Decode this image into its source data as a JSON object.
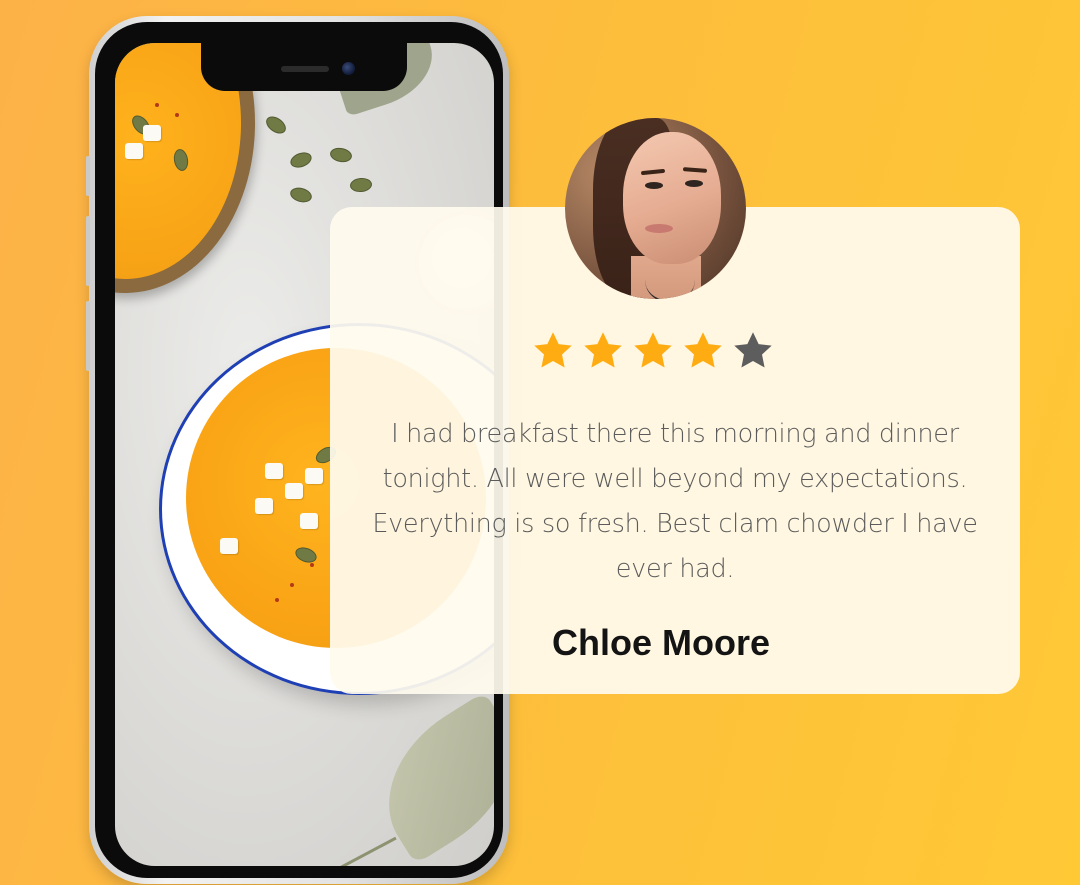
{
  "testimonial": {
    "rating": 4,
    "max_rating": 5,
    "review": "I had breakfast there this morning and dinner tonight. All were well beyond my expectations. Everything is so fresh. Best clam chowder I have ever had.",
    "reviewer_name": "Chloe Moore",
    "avatar_icon": "woman-portrait"
  },
  "phone": {
    "screen_image": "pumpkin-soup-bowls"
  },
  "colors": {
    "background_start": "#fdb248",
    "background_end": "#ffc936",
    "star_filled": "#ffac12",
    "star_empty": "#5d5d5d",
    "card": "#fffbee",
    "name_text": "#141414",
    "review_text": "#5b5b5b"
  }
}
